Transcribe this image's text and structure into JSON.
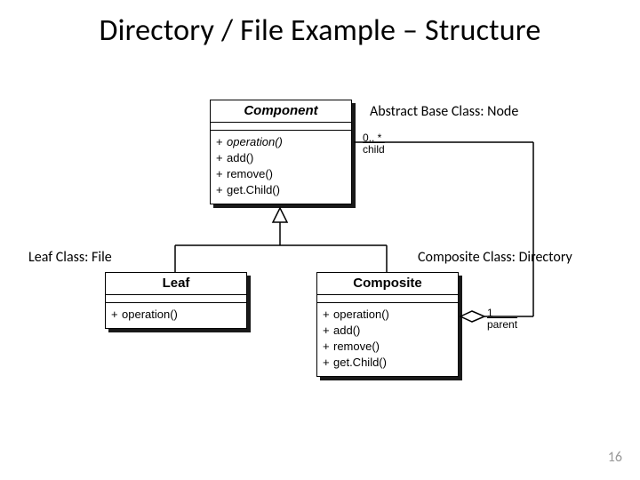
{
  "title": "Directory / File Example – Structure",
  "annotations": {
    "abstract": "Abstract Base Class: Node",
    "leaf": "Leaf Class: File",
    "composite": "Composite Class: Directory"
  },
  "page_number": "16",
  "uml": {
    "component": {
      "name": "Component",
      "name_italic": true,
      "ops": [
        {
          "vis": "+",
          "sig": "operation()",
          "italic": true
        },
        {
          "vis": "+",
          "sig": "add()"
        },
        {
          "vis": "+",
          "sig": "remove()"
        },
        {
          "vis": "+",
          "sig": "get.Child()"
        }
      ]
    },
    "leaf": {
      "name": "Leaf",
      "ops": [
        {
          "vis": "+",
          "sig": "operation()"
        }
      ]
    },
    "composite": {
      "name": "Composite",
      "ops": [
        {
          "vis": "+",
          "sig": "operation()"
        },
        {
          "vis": "+",
          "sig": "add()"
        },
        {
          "vis": "+",
          "sig": "remove()"
        },
        {
          "vis": "+",
          "sig": "get.Child()"
        }
      ]
    }
  },
  "assoc": {
    "child_mult": "0.. *",
    "child_role": "child",
    "parent_mult": "1",
    "parent_role": "parent"
  },
  "chart_data": {
    "type": "diagram",
    "pattern": "Composite (UML)",
    "classes": [
      {
        "id": "Component",
        "abstract": true,
        "note": "Abstract Base Class: Node",
        "operations": [
          {
            "visibility": "+",
            "name": "operation()",
            "abstract": true
          },
          {
            "visibility": "+",
            "name": "add()"
          },
          {
            "visibility": "+",
            "name": "remove()"
          },
          {
            "visibility": "+",
            "name": "get.Child()"
          }
        ]
      },
      {
        "id": "Leaf",
        "note": "Leaf Class: File",
        "operations": [
          {
            "visibility": "+",
            "name": "operation()"
          }
        ]
      },
      {
        "id": "Composite",
        "note": "Composite Class: Directory",
        "operations": [
          {
            "visibility": "+",
            "name": "operation()"
          },
          {
            "visibility": "+",
            "name": "add()"
          },
          {
            "visibility": "+",
            "name": "remove()"
          },
          {
            "visibility": "+",
            "name": "get.Child()"
          }
        ]
      }
    ],
    "relationships": [
      {
        "type": "generalization",
        "from": "Leaf",
        "to": "Component"
      },
      {
        "type": "generalization",
        "from": "Composite",
        "to": "Component"
      },
      {
        "type": "aggregation",
        "whole": "Composite",
        "part": "Component",
        "part_multiplicity": "0..*",
        "part_role": "child",
        "whole_multiplicity": "1",
        "whole_role": "parent"
      }
    ]
  }
}
